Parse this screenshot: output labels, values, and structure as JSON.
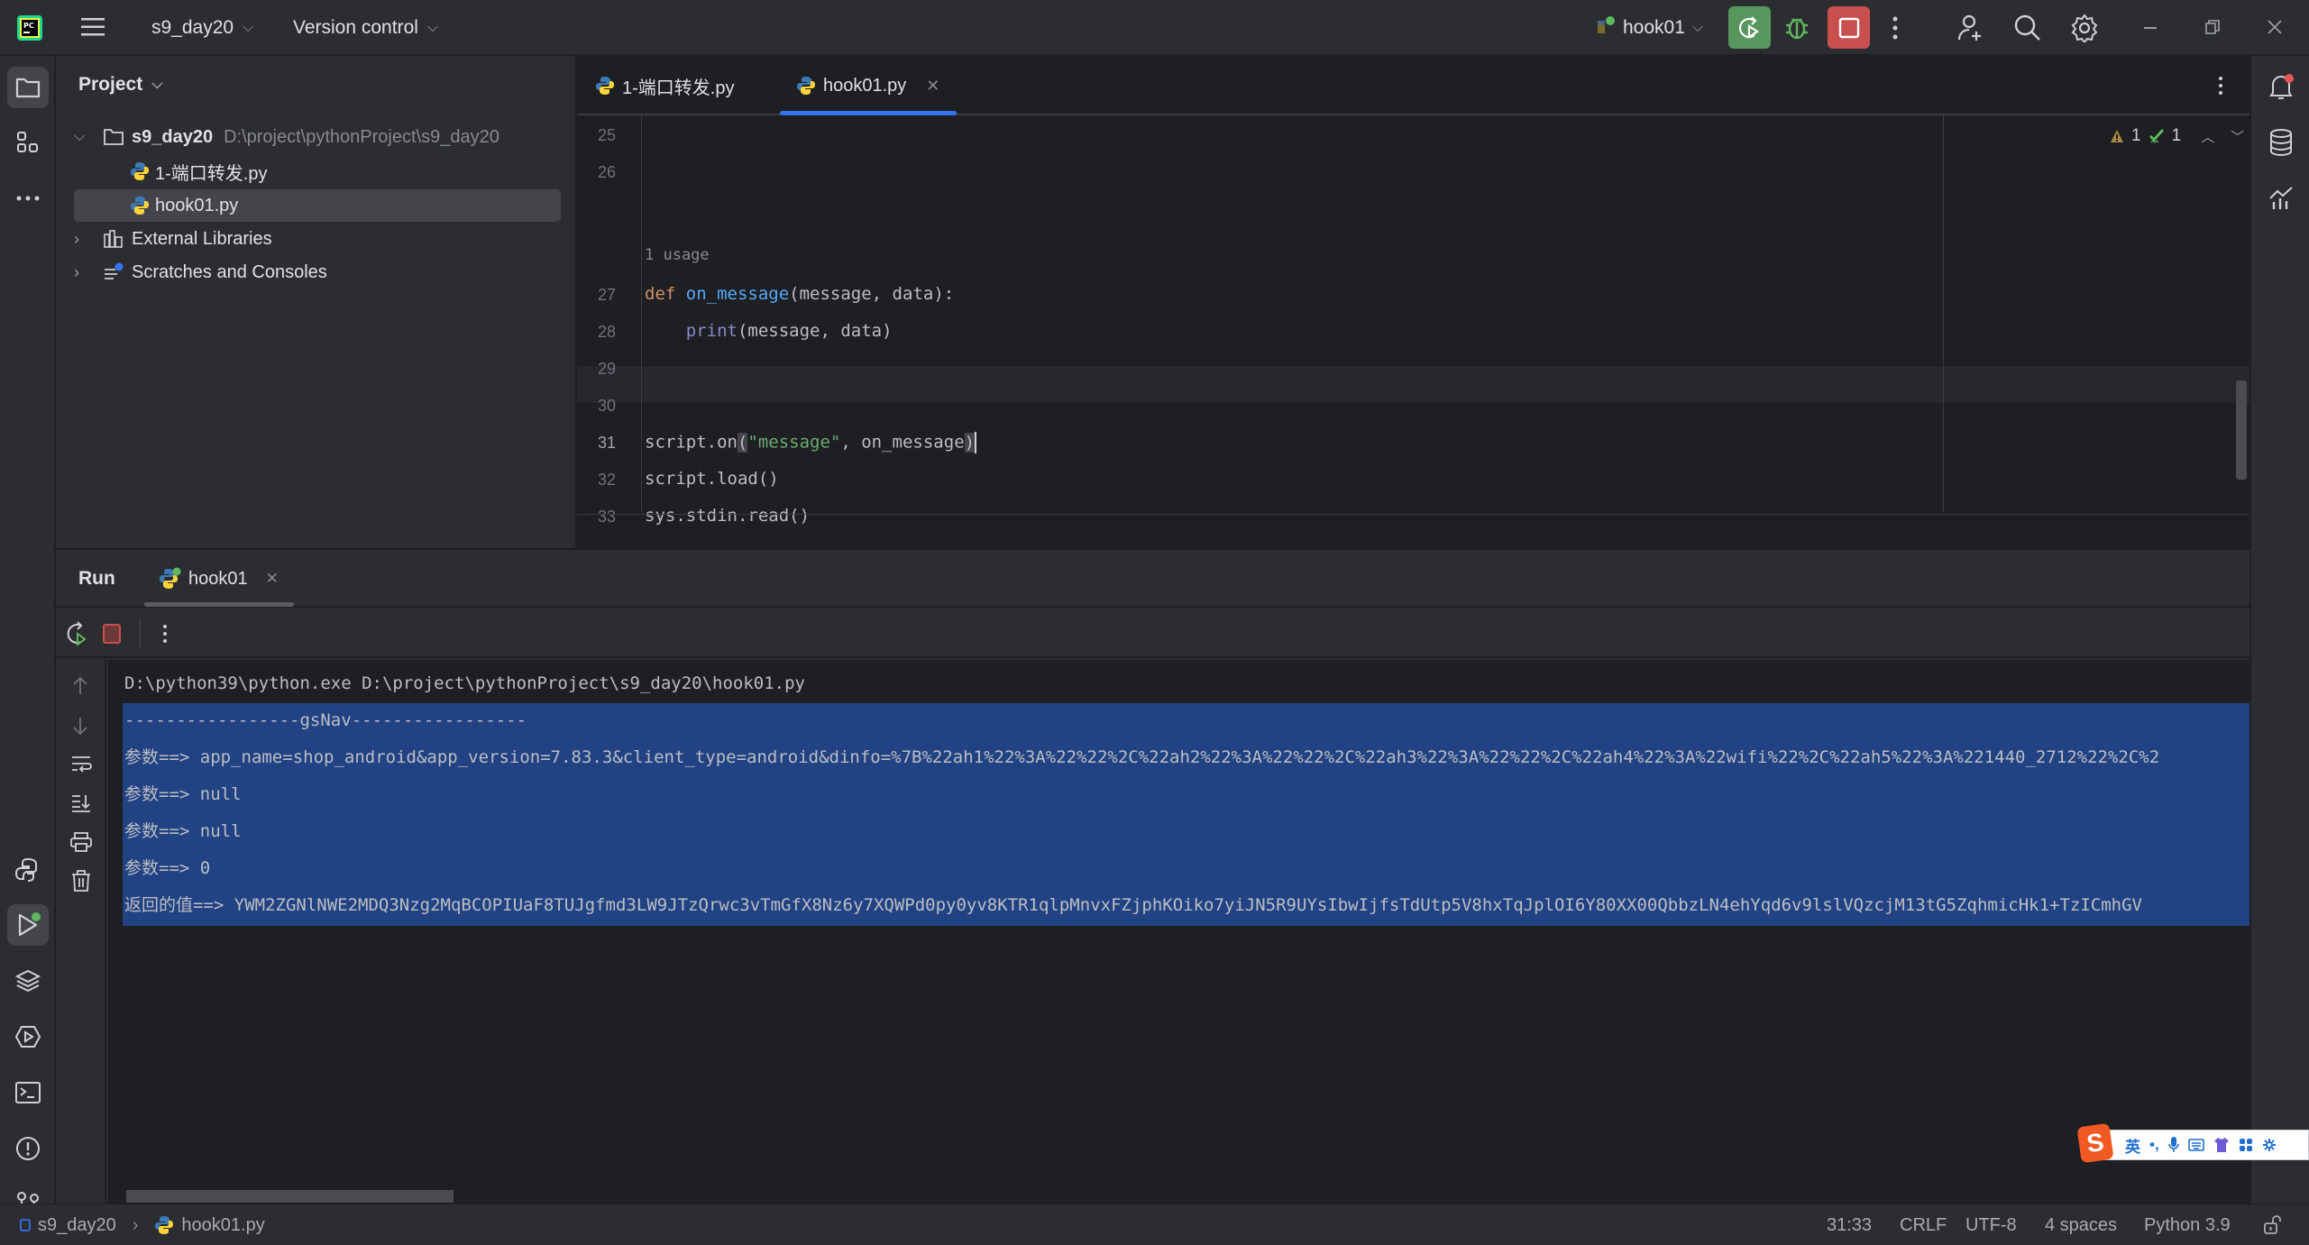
{
  "titlebar": {
    "project_name": "s9_day20",
    "vcs_label": "Version control",
    "run_config": "hook01",
    "window_controls": [
      "minimize",
      "restore",
      "close"
    ]
  },
  "project_panel": {
    "title": "Project",
    "tree": [
      {
        "label": "s9_day20",
        "path": "D:\\project\\pythonProject\\s9_day20",
        "type": "folder",
        "expanded": true
      },
      {
        "label": "1-端口转发.py",
        "type": "python-file"
      },
      {
        "label": "hook01.py",
        "type": "python-file",
        "selected": true
      },
      {
        "label": "External Libraries",
        "type": "libraries",
        "expanded": false
      },
      {
        "label": "Scratches and Consoles",
        "type": "scratches",
        "expanded": false
      }
    ]
  },
  "editor": {
    "tabs": [
      {
        "label": "1-端口转发.py",
        "active": false
      },
      {
        "label": "hook01.py",
        "active": true
      }
    ],
    "inspections": {
      "warnings": "1",
      "weak_warnings": "1"
    },
    "usage_hint": "1 usage",
    "lines": [
      {
        "num": "25",
        "text": ""
      },
      {
        "num": "26",
        "text": ""
      },
      {
        "num": "27",
        "text": "def on_message(message, data):"
      },
      {
        "num": "28",
        "text": "    print(message, data)"
      },
      {
        "num": "29",
        "text": ""
      },
      {
        "num": "30",
        "text": ""
      },
      {
        "num": "31",
        "text": "script.on(\"message\", on_message)"
      },
      {
        "num": "32",
        "text": "script.load()"
      },
      {
        "num": "33",
        "text": "sys.stdin.read()"
      }
    ],
    "current_line": "31"
  },
  "run_panel": {
    "title": "Run",
    "tab_label": "hook01",
    "console": [
      "D:\\python39\\python.exe D:\\project\\pythonProject\\s9_day20\\hook01.py",
      "-----------------gsNav-----------------",
      "参数==> app_name=shop_android&app_version=7.83.3&client_type=android&dinfo=%7B%22ah1%22%3A%22%22%2C%22ah2%22%3A%22%22%2C%22ah3%22%3A%22%22%2C%22ah4%22%3A%22wifi%22%2C%22ah5%22%3A%221440_2712%22%2C%2",
      "参数==> null",
      "参数==> null",
      "参数==> 0",
      "返回的值==> YWM2ZGNlNWE2MDQ3Nzg2MqBCOPIUaF8TUJgfmd3LW9JTzQrwc3vTmGfX8Nz6y7XQWPd0py0yv8KTR1qlpMnvxFZjphKOiko7yiJN5R9UYsIbwIjfsTdUtp5V8hxTqJplOI6Y80XX00QbbzLN4ehYqd6v9lslVQzcjM13tG5ZqhmicHk1+TzICmhGV"
    ]
  },
  "statusbar": {
    "breadcrumb": [
      "s9_day20",
      "hook01.py"
    ],
    "caret_position": "31:33",
    "line_separator": "CRLF",
    "encoding": "UTF-8",
    "indent": "4 spaces",
    "interpreter": "Python 3.9"
  },
  "ime": {
    "mode_label": "英",
    "punct_label": "•,"
  },
  "colors": {
    "accent": "#3574f0",
    "run_button": "#57965c",
    "stop_button": "#c94f4f",
    "selection": "#214283"
  }
}
